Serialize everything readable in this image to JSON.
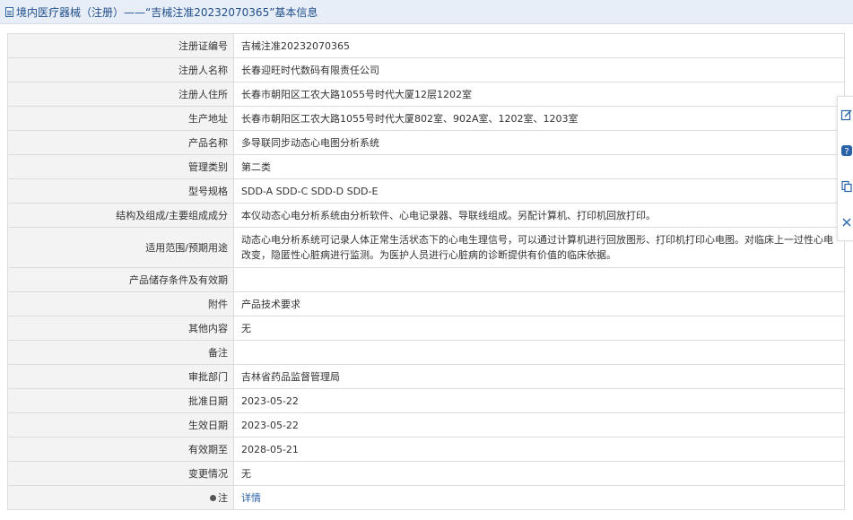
{
  "header": {
    "title": "境内医疗器械（注册）——“吉械注准20232070365”基本信息",
    "icon": "document-icon"
  },
  "rows": [
    {
      "label": "注册证编号",
      "value": "吉械注准20232070365"
    },
    {
      "label": "注册人名称",
      "value": "长春迎旺时代数码有限责任公司"
    },
    {
      "label": "注册人住所",
      "value": "长春市朝阳区工农大路1055号时代大厦12层1202室"
    },
    {
      "label": "生产地址",
      "value": "长春市朝阳区工农大路1055号时代大厦802室、902A室、1202室、1203室"
    },
    {
      "label": "产品名称",
      "value": "多导联同步动态心电图分析系统"
    },
    {
      "label": "管理类别",
      "value": "第二类"
    },
    {
      "label": "型号规格",
      "value": "SDD-A SDD-C SDD-D SDD-E"
    },
    {
      "label": "结构及组成/主要组成成分",
      "value": "本仪动态心电分析系统由分析软件、心电记录器、导联线组成。另配计算机、打印机回放打印。"
    },
    {
      "label": "适用范围/预期用途",
      "value": "动态心电分析系统可记录人体正常生活状态下的心电生理信号，可以通过计算机进行回放图形、打印机打印心电图。对临床上一过性心电改变，隐匿性心脏病进行监测。为医护人员进行心脏病的诊断提供有价值的临床依据。"
    },
    {
      "label": "产品储存条件及有效期",
      "value": ""
    },
    {
      "label": "附件",
      "value": "产品技术要求"
    },
    {
      "label": "其他内容",
      "value": "无"
    },
    {
      "label": "备注",
      "value": ""
    },
    {
      "label": "审批部门",
      "value": "吉林省药品监督管理局"
    },
    {
      "label": "批准日期",
      "value": "2023-05-22"
    },
    {
      "label": "生效日期",
      "value": "2023-05-22"
    },
    {
      "label": "有效期至",
      "value": "2028-05-21"
    },
    {
      "label": "变更情况",
      "value": "无"
    }
  ],
  "note_row": {
    "label": "注",
    "link": "详情",
    "icon": "bullet-icon"
  },
  "side_tools": [
    {
      "icon": "edit-icon"
    },
    {
      "icon": "help-icon"
    },
    {
      "icon": "copy-icon"
    },
    {
      "icon": "close-icon"
    }
  ],
  "colors": {
    "header_bg": "#e8eef7",
    "header_text": "#1f4e8c",
    "label_bg": "#f3f3f3",
    "border": "#dcdcdc",
    "link": "#2a62a8"
  }
}
